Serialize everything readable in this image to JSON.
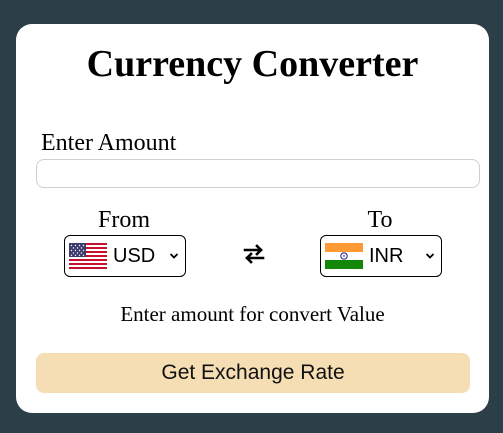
{
  "title": "Currency Converter",
  "amount": {
    "label": "Enter Amount",
    "value": "",
    "placeholder": ""
  },
  "from": {
    "label": "From",
    "selected_code": "USD",
    "flag_icon": "us-flag-icon"
  },
  "to": {
    "label": "To",
    "selected_code": "INR",
    "flag_icon": "india-flag-icon"
  },
  "message": "Enter amount for convert Value",
  "button_label": "Get Exchange Rate",
  "colors": {
    "background": "#2c3e48",
    "card": "#ffffff",
    "button": "#f5deb3"
  }
}
